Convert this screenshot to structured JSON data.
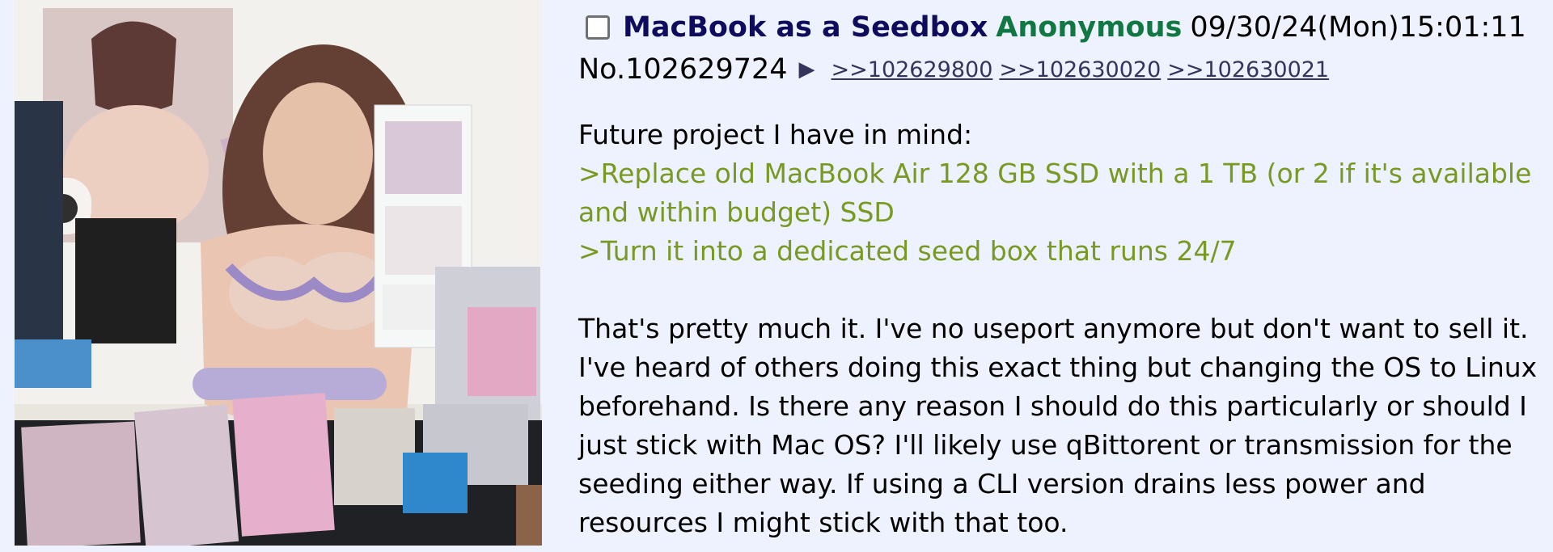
{
  "post": {
    "subject": "MacBook as a Seedbox",
    "name": "Anonymous",
    "datetime": "09/30/24(Mon)15:01:11",
    "number": "No.102629724",
    "arrow": "▶",
    "backlinks": [
      ">>102629800",
      ">>102630020",
      ">>102630021"
    ],
    "message": {
      "intro": "Future project I have in mind:",
      "greentext_1": ">Replace old MacBook Air 128 GB SSD with a 1 TB (or 2 if it's available and within budget) SSD",
      "greentext_2": ">Turn it into a dedicated seed box that runs 24/7",
      "body": "That's pretty much it. I've no useport anymore but don't want to sell it. I've heard of others doing this exact thing but changing the OS to Linux beforehand. Is there any reason I should do this particularly or should I just stick with Mac OS? I'll likely use qBittorent or transmission for the seeding either way. If using a CLI version drains less power and resources I might stick with that too."
    }
  },
  "colors": {
    "background": "#eef2ff",
    "subject": "#0f0c5d",
    "name": "#117743",
    "greentext": "#789922",
    "link": "#34345c"
  },
  "thumbnail": {
    "description_icon": "post-image-thumbnail"
  }
}
